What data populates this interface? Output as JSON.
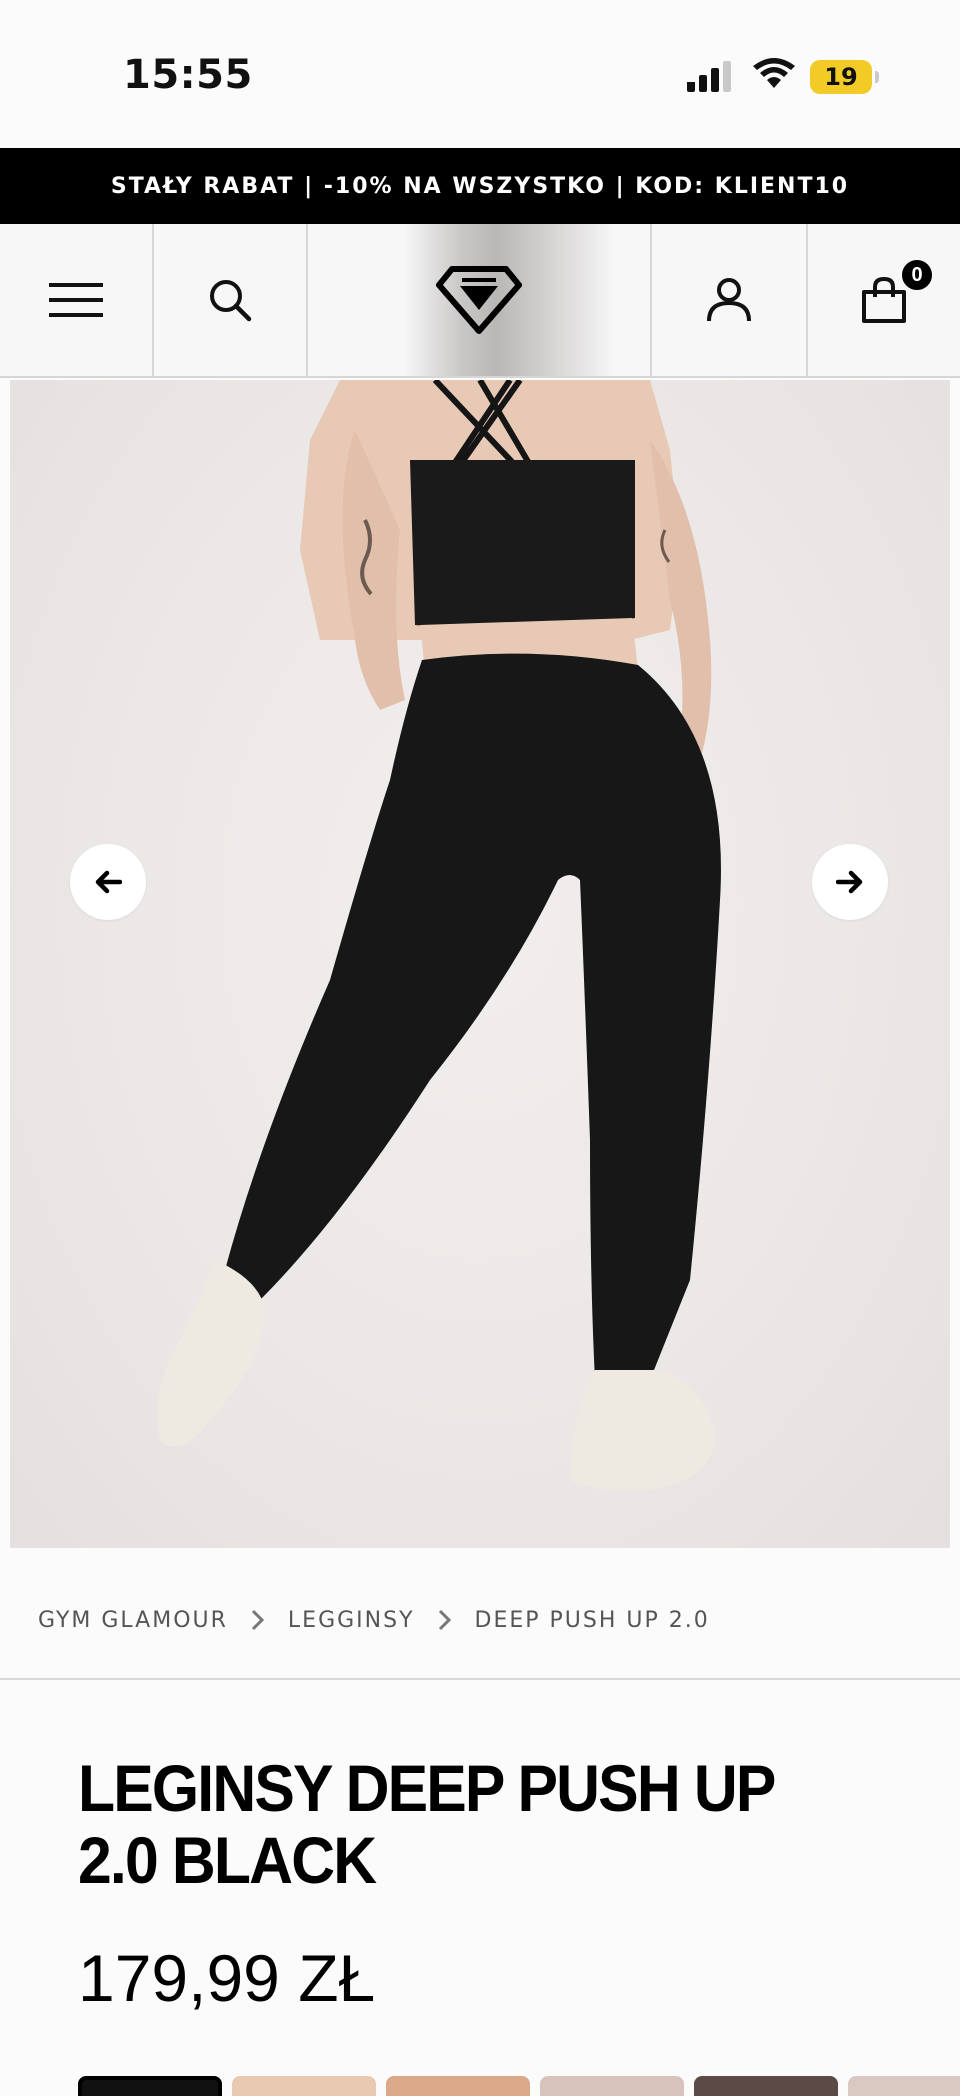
{
  "status_bar": {
    "time": "15:55",
    "battery": "19",
    "icons": [
      "cellular-signal-icon",
      "wifi-icon",
      "battery-icon"
    ]
  },
  "promo": {
    "text": "STAŁY RABAT | -10% NA WSZYSTKO | KOD: KLIENT10"
  },
  "header": {
    "icons": [
      "menu-icon",
      "search-icon",
      "brand-logo",
      "account-icon",
      "cart-icon"
    ],
    "cart_count": "0"
  },
  "gallery": {
    "image_description": "product-photo",
    "prev_icon": "arrow-left-icon",
    "next_icon": "arrow-right-icon"
  },
  "breadcrumb": {
    "items": [
      "GYM GLAMOUR",
      "LEGGINSY",
      "DEEP PUSH UP 2.0"
    ],
    "separator_icon": "chevron-right-icon"
  },
  "product": {
    "title": "LEGINSY DEEP PUSH UP 2.0 BLACK",
    "price": "179,99 ZŁ"
  },
  "thumbnails": {
    "colors": [
      "#111111",
      "#e9c9b0",
      "#d9a98a",
      "#d8c4bd",
      "#5b4a45",
      "#d9c9c2",
      "#8a1f5c"
    ]
  }
}
